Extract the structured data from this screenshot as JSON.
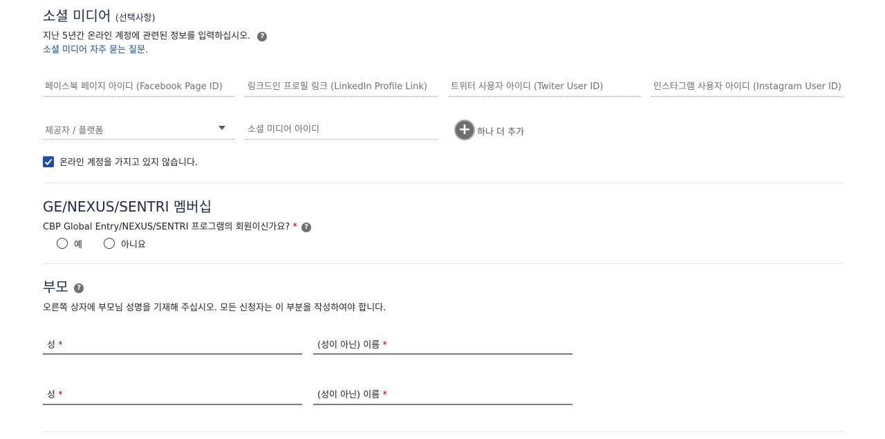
{
  "social": {
    "title": "소셜 미디어",
    "title_suffix": "(선택사항)",
    "subtitle": "지난 5년간 온라인 계정에 관련된 정보를 입력하십시오.",
    "faq_link": "소셜 미디어 자주 묻는 질문.",
    "fields": [
      "페이스북 페이지 아이디 (Facebook Page ID)",
      "링크드인 프로필 링크 (LinkedIn Profile Link)",
      "트위터 사용자 아이디 (Twiter User ID)",
      "인스타그램 사용자 아이디 (Instagram User ID)"
    ],
    "provider_placeholder": "제공자 / 플랫폼",
    "id_placeholder": "소셜 미디어 아이디",
    "add_more_label": "하나 더 추가",
    "no_account_label": "온라인 계정을 가지고 있지 않습니다.",
    "no_account_checked": true
  },
  "ge": {
    "title": "GE/NEXUS/SENTRI 멤버십",
    "question": "CBP Global Entry/NEXUS/SENTRI 프로그램의 회원이신가요?",
    "required_mark": "*",
    "options": [
      "예",
      "아니요"
    ]
  },
  "parents": {
    "title": "부모",
    "subtitle": "오른쪽 상자에 부모님 성명을 기재해 주십시오. 모든 신청자는 이 부분을 작성하여야 합니다.",
    "surname_label": "성",
    "given_label": "(성이 아닌) 이름",
    "required_mark": "*"
  },
  "icons": {
    "help": "question-icon",
    "add": "plus-icon",
    "dropdown": "caret-down-icon",
    "check": "check-icon"
  },
  "colors": {
    "title": "#1b2a4a",
    "link": "#1a4d8f",
    "checkbox": "#1f4fa8",
    "required": "#b00020"
  }
}
